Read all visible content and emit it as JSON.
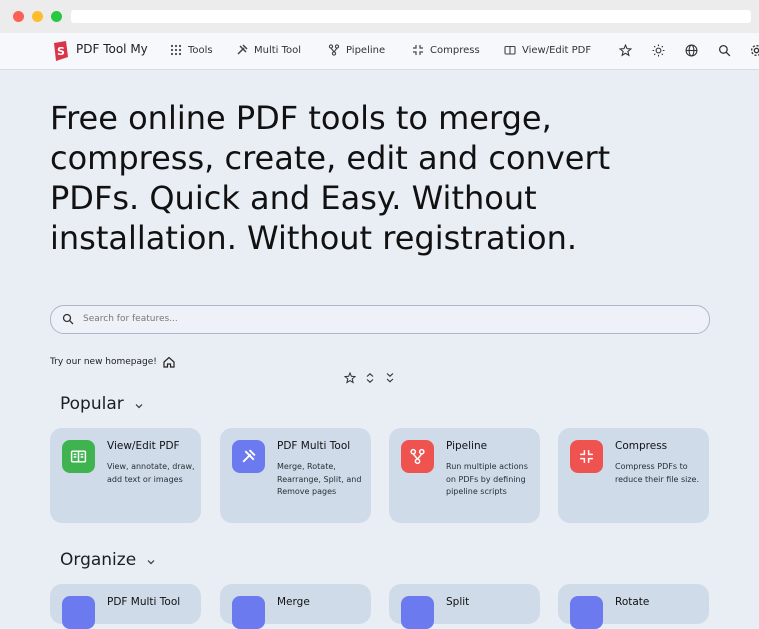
{
  "brand": {
    "name": "PDF Tool My"
  },
  "nav": {
    "items": [
      {
        "label": "Tools",
        "icon": "grid-icon"
      },
      {
        "label": "Multi Tool",
        "icon": "tools-icon"
      },
      {
        "label": "Pipeline",
        "icon": "pipeline-icon"
      },
      {
        "label": "Compress",
        "icon": "compress-icon"
      },
      {
        "label": "View/Edit PDF",
        "icon": "book-icon"
      }
    ],
    "right_icons": [
      "star-icon",
      "sun-icon",
      "globe-icon",
      "search-icon",
      "gear-icon"
    ]
  },
  "hero": {
    "heading": "Free online PDF tools to merge, compress, create, edit and convert PDFs. Quick and Easy. Without installation. Without registration."
  },
  "search": {
    "placeholder": "Search for features..."
  },
  "homepage_link": "Try our new homepage!",
  "sections": [
    {
      "title": "Popular",
      "cards": [
        {
          "title": "View/Edit PDF",
          "desc": "View, annotate, draw, add text or images",
          "color": "#3fb34f"
        },
        {
          "title": "PDF Multi Tool",
          "desc": "Merge, Rotate, Rearrange, Split, and Remove pages",
          "color": "#6c7af0"
        },
        {
          "title": "Pipeline",
          "desc": "Run multiple actions on PDFs by defining pipeline scripts",
          "color": "#ef5350"
        },
        {
          "title": "Compress",
          "desc": "Compress PDFs to reduce their file size.",
          "color": "#ef5350"
        }
      ]
    },
    {
      "title": "Organize",
      "cards": [
        {
          "title": "PDF Multi Tool",
          "color": "#6c7af0"
        },
        {
          "title": "Merge",
          "color": "#6c7af0"
        },
        {
          "title": "Split",
          "color": "#6c7af0"
        },
        {
          "title": "Rotate",
          "color": "#6c7af0"
        }
      ]
    }
  ],
  "colors": {
    "background": "#e9edf4",
    "card": "#cfdbe9",
    "accent_red": "#e8384f"
  }
}
